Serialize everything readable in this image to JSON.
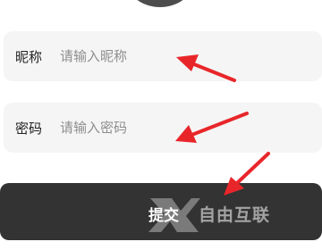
{
  "form": {
    "nickname": {
      "label": "昵称",
      "placeholder": "请输入昵称",
      "value": ""
    },
    "password": {
      "label": "密码",
      "placeholder": "请输入密码",
      "value": ""
    },
    "submit_label": "提交"
  },
  "watermark": {
    "text": "自由互联",
    "icon": "x-logo-icon"
  },
  "annotations": {
    "arrow_color": "#e8262a",
    "icon": "red-arrow-icon"
  },
  "colors": {
    "field_background": "#f5f5f5",
    "button_background": "#333333",
    "avatar": "#4d4d4d"
  }
}
